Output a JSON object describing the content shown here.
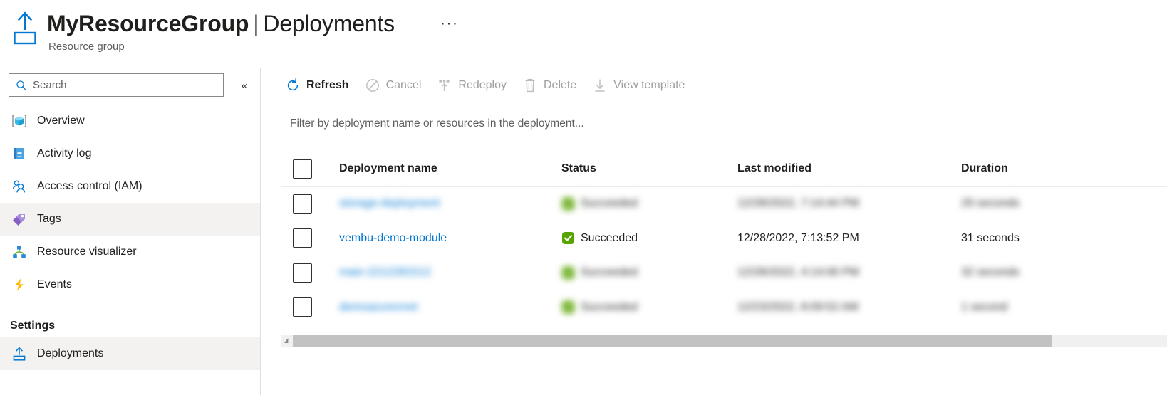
{
  "header": {
    "icon": "deployment-upload-icon",
    "resource_name": "MyResourceGroup",
    "separator": "|",
    "page_name": "Deployments",
    "ellipsis": "···",
    "subtitle": "Resource group"
  },
  "sidebar": {
    "search": {
      "icon": "search-icon",
      "placeholder": "Search",
      "value": ""
    },
    "collapse": {
      "icon": "chevron-double-left-icon",
      "glyph": "«"
    },
    "items": [
      {
        "label": "Overview",
        "icon": "overview-cube-icon",
        "selected": false
      },
      {
        "label": "Activity log",
        "icon": "activity-log-book-icon",
        "selected": false
      },
      {
        "label": "Access control (IAM)",
        "icon": "access-control-users-icon",
        "selected": false
      },
      {
        "label": "Tags",
        "icon": "tags-icon",
        "selected": true
      },
      {
        "label": "Resource visualizer",
        "icon": "resource-visualizer-icon",
        "selected": false
      },
      {
        "label": "Events",
        "icon": "events-lightning-icon",
        "selected": false
      }
    ],
    "group_label": "Settings",
    "settings_items": [
      {
        "label": "Deployments",
        "icon": "deployment-upload-icon",
        "selected": true
      }
    ]
  },
  "toolbar": {
    "buttons": [
      {
        "label": "Refresh",
        "icon": "refresh-icon",
        "disabled": false
      },
      {
        "label": "Cancel",
        "icon": "cancel-icon",
        "disabled": true
      },
      {
        "label": "Redeploy",
        "icon": "redeploy-icon",
        "disabled": true
      },
      {
        "label": "Delete",
        "icon": "trash-icon",
        "disabled": true
      },
      {
        "label": "View template",
        "icon": "download-icon",
        "disabled": true
      }
    ]
  },
  "filter": {
    "placeholder": "Filter by deployment name or resources in the deployment...",
    "value": ""
  },
  "table": {
    "select_all_checkbox": "",
    "columns": [
      "Deployment name",
      "Status",
      "Last modified",
      "Duration"
    ],
    "rows": [
      {
        "name": "storage-deployment",
        "status": "Succeeded",
        "last_modified": "12/28/2022, 7:14:44 PM",
        "duration": "29 seconds",
        "redacted": true
      },
      {
        "name": "vembu-demo-module",
        "status": "Succeeded",
        "last_modified": "12/28/2022, 7:13:52 PM",
        "duration": "31 seconds",
        "redacted": false
      },
      {
        "name": "main-2212281512",
        "status": "Succeeded",
        "last_modified": "12/28/2022, 4:14:06 PM",
        "duration": "32 seconds",
        "redacted": true
      },
      {
        "name": "demoazurevnet",
        "status": "Succeeded",
        "last_modified": "12/23/2022, 8:09:52 AM",
        "duration": "1 second",
        "redacted": true
      }
    ]
  },
  "scrollbar": {
    "left_arrow_icon": "scroll-left-arrow-icon"
  },
  "colors": {
    "accent": "#0078d4",
    "success": "#57a300",
    "link": "#0078d4",
    "selected_bg": "#f3f2f1",
    "border": "#e1dfdd",
    "disabled_text": "#a19f9d"
  }
}
